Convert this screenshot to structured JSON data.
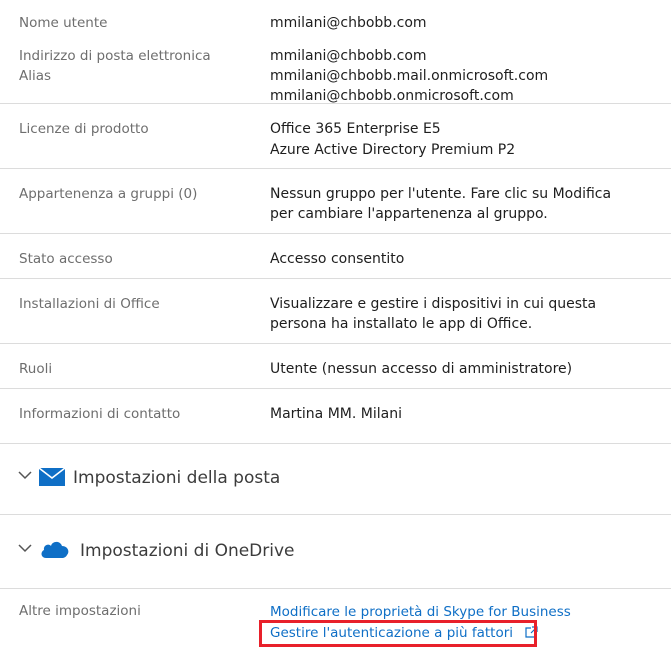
{
  "rows": {
    "username": {
      "label": "Nome utente",
      "value": "mmilani@chbobb.com"
    },
    "email": {
      "label": "Indirizzo di posta elettronica",
      "value": "mmilani@chbobb.com"
    },
    "alias": {
      "label": "Alias",
      "values": [
        "mmilani@chbobb.mail.onmicrosoft.com",
        "mmilani@chbobb.onmicrosoft.com"
      ]
    },
    "licenses": {
      "label": "Licenze di prodotto",
      "values": [
        "Office 365 Enterprise E5",
        "Azure Active Directory Premium P2"
      ]
    },
    "groups": {
      "label": "Appartenenza a gruppi (0)",
      "values": [
        "Nessun gruppo per l'utente. Fare clic su Modifica",
        "per cambiare l'appartenenza al gruppo."
      ]
    },
    "signin": {
      "label": "Stato accesso",
      "value": "Accesso consentito"
    },
    "office_installs": {
      "label": "Installazioni di Office",
      "values": [
        "Visualizzare e gestire i dispositivi in cui questa",
        "persona ha installato le app di Office."
      ]
    },
    "roles": {
      "label": "Ruoli",
      "value": "Utente (nessun accesso di amministratore)"
    },
    "contact": {
      "label": "Informazioni di contatto",
      "value": "Martina MM. Milani"
    }
  },
  "sections": {
    "mail": {
      "title": "Impostazioni della posta",
      "icon": "mail-envelope-icon"
    },
    "onedrive": {
      "title": "Impostazioni di OneDrive",
      "icon": "onedrive-cloud-icon"
    }
  },
  "more_settings": {
    "label": "Altre impostazioni",
    "links": [
      "Modificare le proprietà di Skype for Business",
      "Gestire l'autenticazione a più fattori"
    ],
    "external_icon": "external-link-icon"
  },
  "colors": {
    "accent": "#0f6fc6",
    "highlight": "#e8202a",
    "separator": "#dcdcdc"
  }
}
